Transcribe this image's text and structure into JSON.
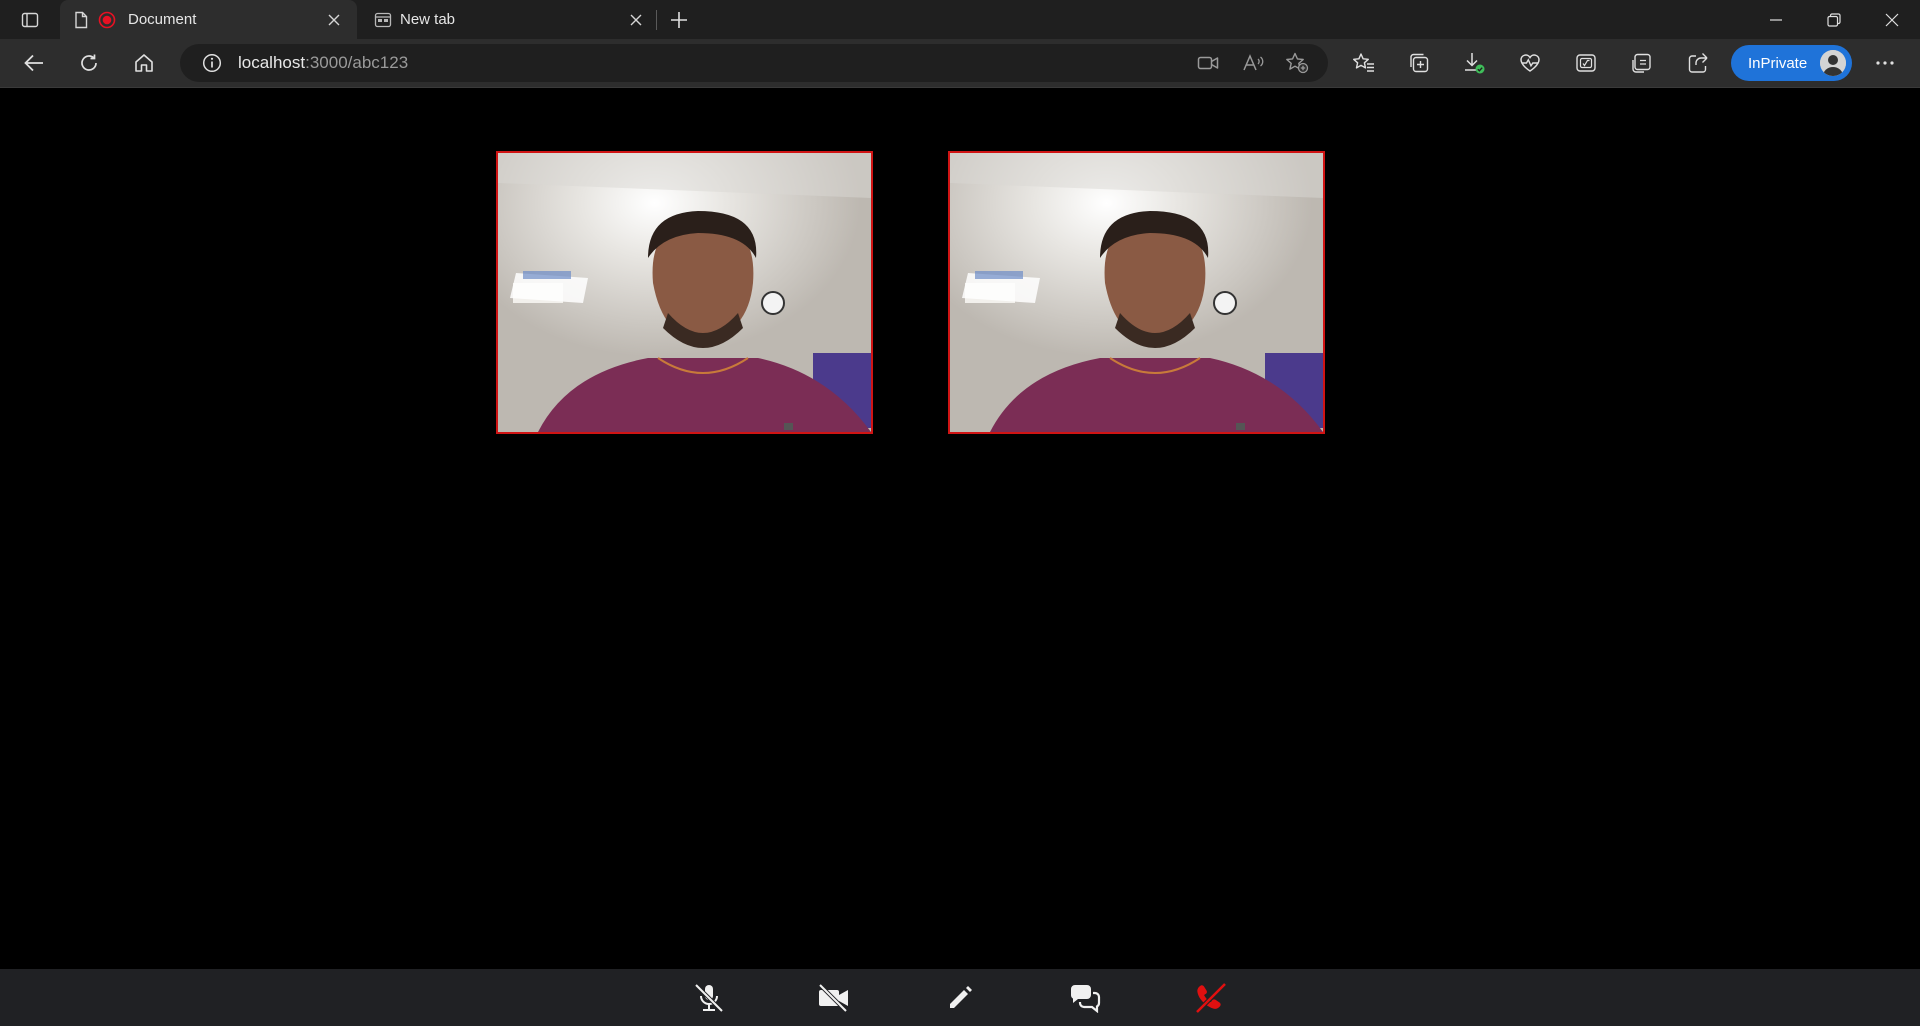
{
  "browser": {
    "tabs": [
      {
        "title": "Document",
        "active": true,
        "recording": true
      },
      {
        "title": "New tab",
        "active": false
      }
    ],
    "address": {
      "host": "localhost",
      "path": ":3000/abc123"
    },
    "profile_label": "InPrivate",
    "colors": {
      "inprivate": "#1f73d9",
      "tab_active": "#2d2d2d",
      "tabstrip": "#1f1f1f"
    },
    "toolbar_icons": [
      "back-icon",
      "refresh-icon",
      "home-icon",
      "site-info-icon",
      "camera-permission-icon",
      "read-aloud-icon",
      "add-favorite-icon",
      "favorites-icon",
      "collections-icon",
      "downloads-icon",
      "browser-essentials-icon",
      "math-solver-icon",
      "sidebar-icon",
      "share-icon",
      "more-icon"
    ]
  },
  "videos": [
    {
      "name": "local-video",
      "border_color": "#d01414"
    },
    {
      "name": "remote-video",
      "border_color": "#d01414"
    }
  ],
  "controls": {
    "buttons": [
      "mute-mic-button",
      "stop-video-button",
      "whiteboard-button",
      "chat-button",
      "end-call-button"
    ],
    "end_call_color": "#e01010"
  }
}
